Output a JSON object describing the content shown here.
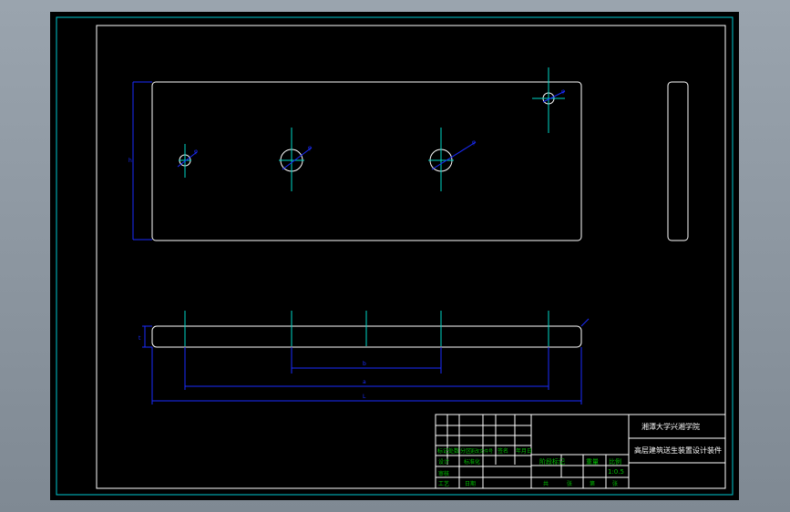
{
  "title_block": {
    "school": "湘潭大学兴湘学院",
    "project": "高层建筑送生装置设计装件",
    "scale": "1:0.5",
    "sign_labels": [
      "标记",
      "处数",
      "分区",
      "更改文件号",
      "签名",
      "年月日"
    ],
    "role_labels": [
      "设计",
      "标准化",
      "审核",
      "工艺",
      "日期"
    ],
    "stage_labels": [
      "阶段标记",
      "重量",
      "比例"
    ],
    "sheet_labels": [
      "共",
      "张",
      "第",
      "张"
    ]
  },
  "dimensions": {
    "hole_diameter_small": "φ",
    "hole_diameter_large": "φ",
    "plate_height_label": "h",
    "inner_span": "a",
    "mid_span": "b",
    "total_length": "L",
    "thickness": "t"
  },
  "colors": {
    "canvas": "#000000",
    "outer_frame": "#00c8d0",
    "inner_frame": "#ffffff",
    "centerline": "#00d8c8",
    "dimension": "#1a2cff",
    "title_block": "#ffffff",
    "title_grid": "#00c000"
  }
}
